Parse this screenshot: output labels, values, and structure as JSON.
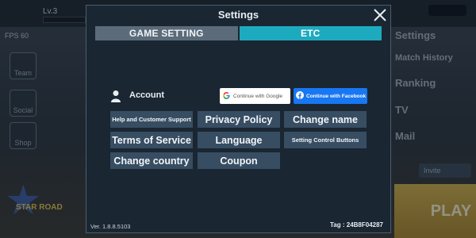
{
  "background": {
    "level": "Lv.3",
    "fps": "FPS 60",
    "side_buttons": [
      "Team",
      "Social",
      "Shop"
    ],
    "right_menu": [
      "Settings",
      "Match History",
      "Ranking",
      "TV",
      "Mail"
    ],
    "badge": "STAR ROAD",
    "invite": "Invite",
    "play": "PLAY"
  },
  "modal": {
    "title": "Settings",
    "tabs": [
      {
        "label": "GAME SETTING",
        "active": false
      },
      {
        "label": "ETC",
        "active": true
      }
    ],
    "account": {
      "label": "Account",
      "google_button": "Continue with Google",
      "facebook_button": "Continue with Facebook"
    },
    "options": {
      "help": "Help and Customer Support",
      "privacy": "Privacy Policy",
      "change_name": "Change name",
      "terms": "Terms of Service",
      "language": "Language",
      "control_buttons": "Setting Control Buttons",
      "change_country": "Change country",
      "coupon": "Coupon"
    },
    "version": "Ver. 1.8.8.5103",
    "tag": "Tag : 24B8F04287"
  },
  "colors": {
    "accent": "#1eaabe",
    "button": "#374d62",
    "panel": "#1a2632",
    "facebook": "#1877f2"
  }
}
